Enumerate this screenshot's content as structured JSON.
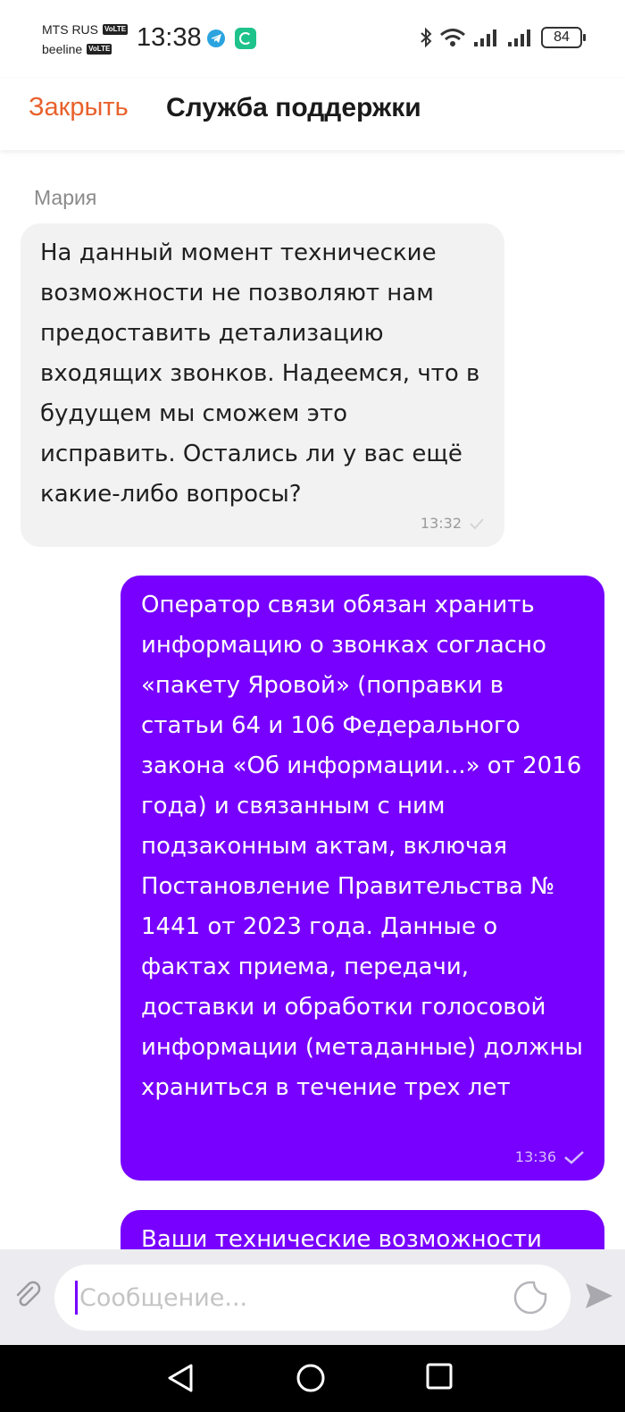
{
  "status_bar": {
    "carrier1": "MTS RUS",
    "carrier2": "beeline",
    "volte": "VoLTE",
    "time": "13:38",
    "battery": "84"
  },
  "header": {
    "close_label": "Закрыть",
    "title": "Служба поддержки"
  },
  "messages": [
    {
      "sender": "Мария",
      "text": "На данный момент технические возможности не позволяют нам предоставить детализацию входящих звонков. Надеемся, что в будущем мы сможем это исправить. Остались ли у вас ещё какие-либо вопросы?",
      "time": "13:32",
      "direction": "incoming"
    },
    {
      "text": "Оператор связи обязан хранить информацию о звонках согласно «пакету Яровой» (поправки в статьи 64 и 106 Федерального закона «Об информации...» от 2016 года) и связанным с ним подзаконным актам, включая Постановление Правительства № 1441 от 2023 года. Данные о фактах приема, передачи, доставки и обработки голосовой информации (метаданные) должны храниться в течение трех лет",
      "time": "13:36",
      "direction": "outgoing"
    },
    {
      "text": "Ваши технические возможности",
      "direction": "outgoing"
    }
  ],
  "composer": {
    "placeholder": "Сообщение..."
  },
  "colors": {
    "accent": "#7700ff",
    "close": "#e8612c",
    "incoming_bg": "#f2f2f2"
  }
}
